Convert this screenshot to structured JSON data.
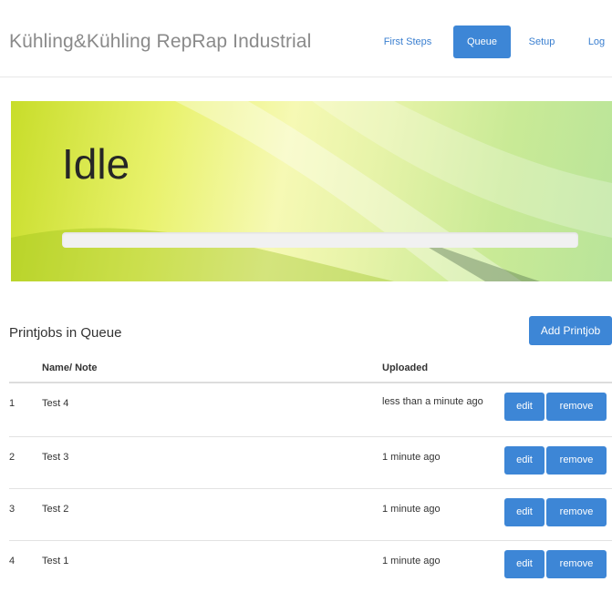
{
  "header": {
    "brand": "Kühling&Kühling RepRap Industrial",
    "nav": [
      {
        "label": "First Steps",
        "active": false
      },
      {
        "label": "Queue",
        "active": true
      },
      {
        "label": "Setup",
        "active": false
      },
      {
        "label": "Log",
        "active": false
      }
    ]
  },
  "status": {
    "title": "Idle",
    "progress": 0
  },
  "queue": {
    "title": "Printjobs in Queue",
    "add_button": "Add Printjob",
    "columns": [
      "",
      "Name/ Note",
      "Uploaded",
      ""
    ],
    "rows": [
      {
        "index": "1",
        "name": "Test 4",
        "uploaded": "less than a minute ago",
        "edit": "edit",
        "remove": "remove"
      },
      {
        "index": "2",
        "name": "Test 3",
        "uploaded": "1 minute ago",
        "edit": "edit",
        "remove": "remove"
      },
      {
        "index": "3",
        "name": "Test 2",
        "uploaded": "1 minute ago",
        "edit": "edit",
        "remove": "remove"
      },
      {
        "index": "4",
        "name": "Test 1",
        "uploaded": "1 minute ago",
        "edit": "edit",
        "remove": "remove"
      }
    ]
  },
  "colors": {
    "accent": "#3d86d6",
    "nav_link": "#3a7fd0",
    "brand_text": "#8a8a8a"
  }
}
